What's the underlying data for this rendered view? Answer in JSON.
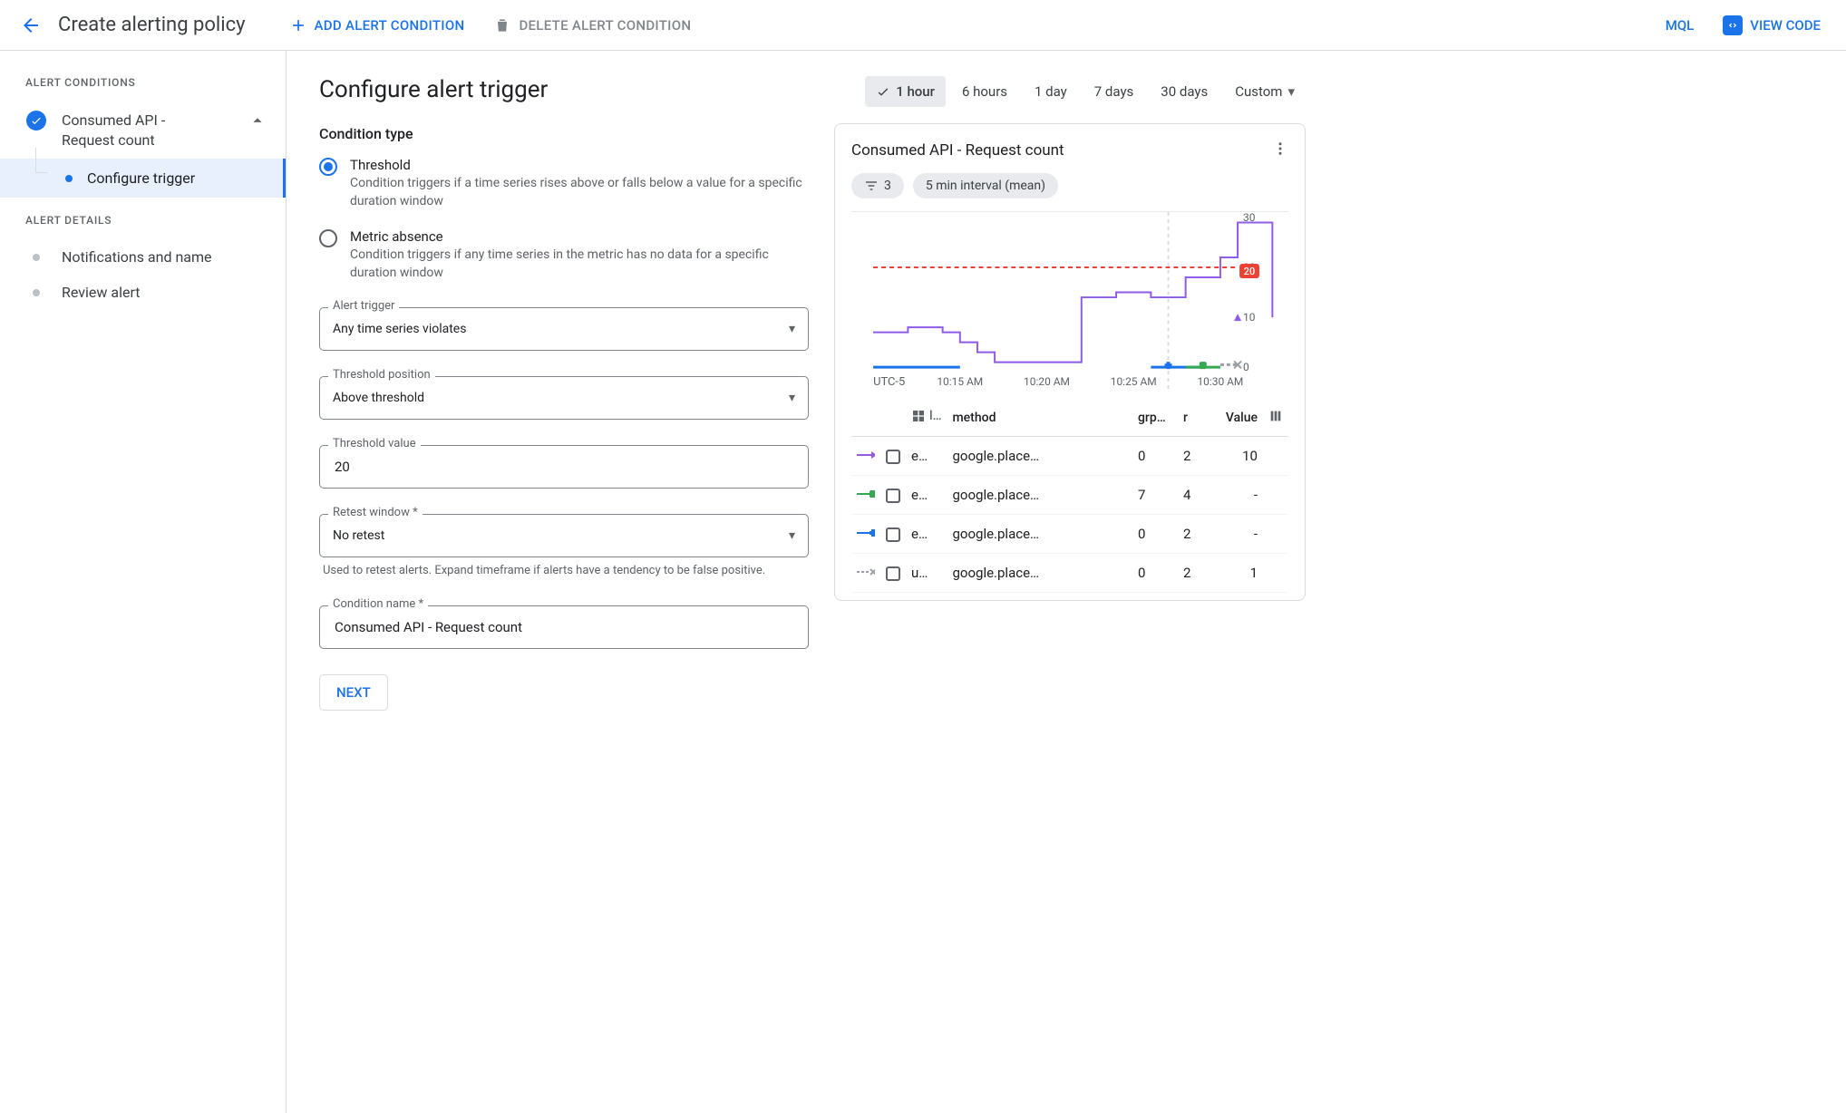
{
  "header": {
    "title": "Create alerting policy",
    "add_condition": "ADD ALERT CONDITION",
    "delete_condition": "DELETE ALERT CONDITION",
    "mql": "MQL",
    "view_code": "VIEW CODE"
  },
  "sidebar": {
    "section_conditions": "ALERT CONDITIONS",
    "condition_name": "Consumed API - Request count",
    "child_configure": "Configure trigger",
    "section_details": "ALERT DETAILS",
    "notifications": "Notifications and name",
    "review": "Review alert"
  },
  "form": {
    "heading": "Configure alert trigger",
    "condition_type_label": "Condition type",
    "radios": {
      "threshold": {
        "label": "Threshold",
        "desc": "Condition triggers if a time series rises above or falls below a value for a specific duration window"
      },
      "absence": {
        "label": "Metric absence",
        "desc": "Condition triggers if any time series in the metric has no data for a specific duration window"
      }
    },
    "alert_trigger": {
      "label": "Alert trigger",
      "value": "Any time series violates"
    },
    "threshold_position": {
      "label": "Threshold position",
      "value": "Above threshold"
    },
    "threshold_value": {
      "label": "Threshold value",
      "value": "20"
    },
    "retest": {
      "label": "Retest window *",
      "value": "No retest",
      "help": "Used to retest alerts. Expand timeframe if alerts have a tendency to be false positive."
    },
    "condition_name": {
      "label": "Condition name *",
      "value": "Consumed API - Request count"
    },
    "next": "NEXT"
  },
  "preview": {
    "time_ranges": [
      "1 hour",
      "6 hours",
      "1 day",
      "7 days",
      "30 days",
      "Custom"
    ],
    "selected_range": "1 hour",
    "card_title": "Consumed API - Request count",
    "filter_count": "3",
    "interval_chip": "5 min interval (mean)",
    "timezone": "UTC-5",
    "threshold_value": "20",
    "table": {
      "headers": {
        "l": "l…",
        "method": "method",
        "grp": "grp…",
        "r": "r",
        "value": "Value"
      },
      "rows": [
        {
          "swatch": "tri",
          "color": "#8f5be8",
          "l": "e…",
          "method": "google.place…",
          "grp": "0",
          "r": "2",
          "value": "10"
        },
        {
          "swatch": "sq",
          "color": "#34a853",
          "l": "e…",
          "method": "google.place…",
          "grp": "7",
          "r": "4",
          "value": "-"
        },
        {
          "swatch": "plus",
          "color": "#1a73e8",
          "l": "e…",
          "method": "google.place…",
          "grp": "0",
          "r": "2",
          "value": "-"
        },
        {
          "swatch": "x",
          "color": "#9aa0a6",
          "l": "u…",
          "method": "google.place…",
          "grp": "0",
          "r": "2",
          "value": "1"
        }
      ]
    }
  },
  "chart_data": {
    "type": "line",
    "title": "Consumed API - Request count",
    "ylabel": "",
    "ylim": [
      0,
      30
    ],
    "y_ticks": [
      0,
      10,
      20,
      30
    ],
    "threshold": 20,
    "x_ticks": [
      "10:15 AM",
      "10:20 AM",
      "10:25 AM",
      "10:30 AM"
    ],
    "cursor_x_index": 17,
    "x": [
      "10:10",
      "10:11",
      "10:12",
      "10:13",
      "10:14",
      "10:15",
      "10:16",
      "10:17",
      "10:18",
      "10:19",
      "10:20",
      "10:21",
      "10:22",
      "10:23",
      "10:24",
      "10:25",
      "10:26",
      "10:27",
      "10:28",
      "10:29",
      "10:30",
      "10:31"
    ],
    "series": [
      {
        "name": "google.place… (e)",
        "color": "#8f5be8",
        "marker": "tri",
        "values": [
          7,
          7,
          8,
          8,
          7,
          5,
          3,
          1,
          1,
          1,
          1,
          1,
          14,
          14,
          15,
          15,
          14,
          14,
          18,
          18,
          22,
          29,
          29,
          10
        ]
      },
      {
        "name": "google.place… (e)",
        "color": "#1a73e8",
        "marker": "plus",
        "values": [
          0,
          0,
          0,
          0,
          0,
          0,
          null,
          null,
          null,
          null,
          null,
          null,
          null,
          null,
          null,
          null,
          0,
          0,
          0,
          0,
          null,
          null
        ]
      },
      {
        "name": "google.place… (e)",
        "color": "#34a853",
        "marker": "sq",
        "values": [
          null,
          null,
          null,
          null,
          null,
          null,
          null,
          null,
          null,
          null,
          null,
          null,
          null,
          null,
          null,
          null,
          null,
          null,
          0,
          0,
          0,
          null
        ]
      },
      {
        "name": "google.place… (u)",
        "color": "#9aa0a6",
        "marker": "x",
        "values": [
          null,
          null,
          null,
          null,
          null,
          null,
          null,
          null,
          null,
          null,
          null,
          null,
          null,
          null,
          null,
          null,
          null,
          null,
          null,
          null,
          0.5,
          0.5
        ]
      }
    ]
  }
}
